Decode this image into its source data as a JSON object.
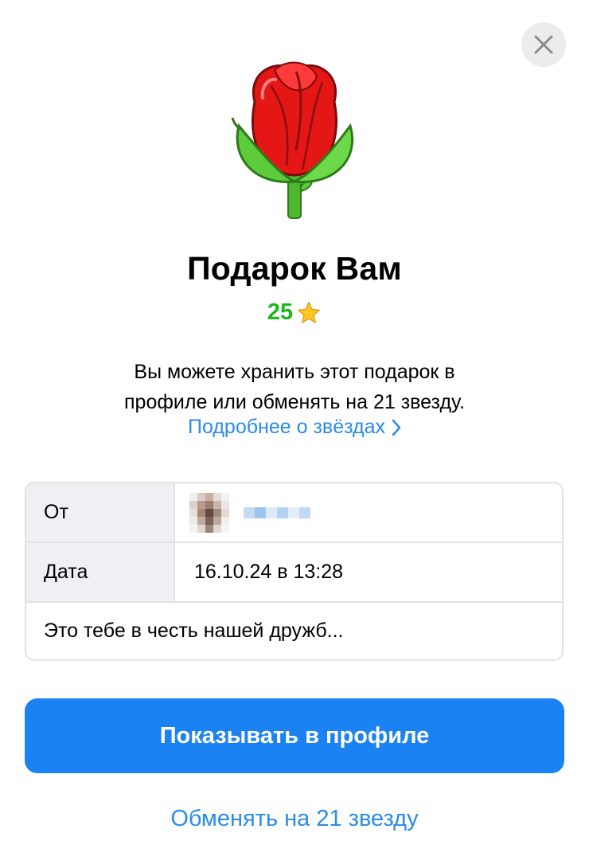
{
  "header": {
    "close_icon": "close-icon",
    "gift_icon": "rose-gift-icon"
  },
  "gift": {
    "title": "Подарок Вам",
    "price": "25",
    "price_icon": "star-icon",
    "description_line1": "Вы можете хранить этот подарок в",
    "description_line2": "профиле или обменять на 21 звезду.",
    "more_link": "Подробнее о звёздах"
  },
  "details": {
    "from_label": "От",
    "date_label": "Дата",
    "date_value": "16.10.24 в 13:28",
    "message": "Это тебе в честь нашей дружб..."
  },
  "actions": {
    "show_in_profile": "Показывать в профиле",
    "convert": "Обменять на 21 звезду"
  },
  "colors": {
    "accent": "#1a82f2",
    "link": "#2a8be9",
    "price": "#1cb81c",
    "table_label_bg": "#efeff4"
  }
}
